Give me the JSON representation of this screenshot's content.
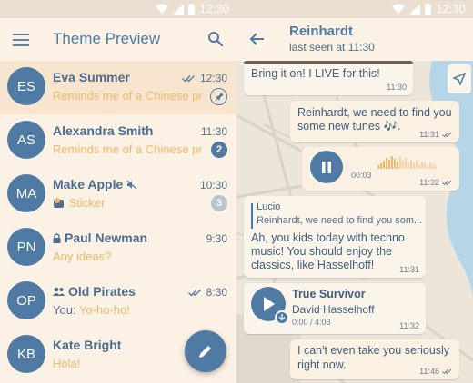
{
  "status_time": "12:30",
  "list": {
    "title": "Theme Preview",
    "chats": [
      {
        "initials": "ES",
        "name": "Eva Summer",
        "preview": "Reminds me of a Chinese prove",
        "time": "12:30",
        "read": true,
        "pinned": true
      },
      {
        "initials": "AS",
        "name": "Alexandra Smith",
        "preview": "Reminds me of a Chinese prove",
        "time": "11:30",
        "badge": "2"
      },
      {
        "initials": "MA",
        "name": "Make Apple",
        "preview": "Sticker",
        "time": "10:30",
        "badge": "3",
        "muted": true
      },
      {
        "initials": "PN",
        "name": "Paul Newman",
        "preview": "Any ideas?",
        "time": "9:30",
        "locked": true
      },
      {
        "initials": "OP",
        "name": "Old Pirates",
        "prefix": "You: ",
        "preview": "Yo-ho-ho!",
        "time": "8:30",
        "group": true,
        "read": true
      },
      {
        "initials": "KB",
        "name": "Kate Bright",
        "preview": "Hola!",
        "time": ""
      }
    ]
  },
  "chat": {
    "name": "Reinhardt",
    "status": "last seen at 11:30",
    "messages": {
      "m1": {
        "text": "Bring it on! I LIVE for this!",
        "time": "11:30"
      },
      "m2": {
        "text1": "Reinhardt, we need to find you",
        "text2": "some new tunes 🎶.",
        "time": "11:31"
      },
      "m3": {
        "elapsed": "00:03",
        "time": "11:32"
      },
      "m4": {
        "reply_name": "Lucio",
        "reply_text": "Reinhardt, we need to find you som...",
        "line1": "Ah, you kids today with techno",
        "line2": "music! You should enjoy the",
        "line3": "classics, like Hasselhoff!",
        "time": "11:31"
      },
      "m5": {
        "title": "True Survivor",
        "artist": "David Hasselhoff",
        "duration": "0:00 / 4:03",
        "time": "11:32"
      },
      "m6": {
        "line1": "I can't even take you seriously",
        "line2": "right now.",
        "time": "11:46"
      }
    }
  },
  "colors": {
    "accent": "#4f7aa3",
    "preview": "#f0b86a"
  }
}
